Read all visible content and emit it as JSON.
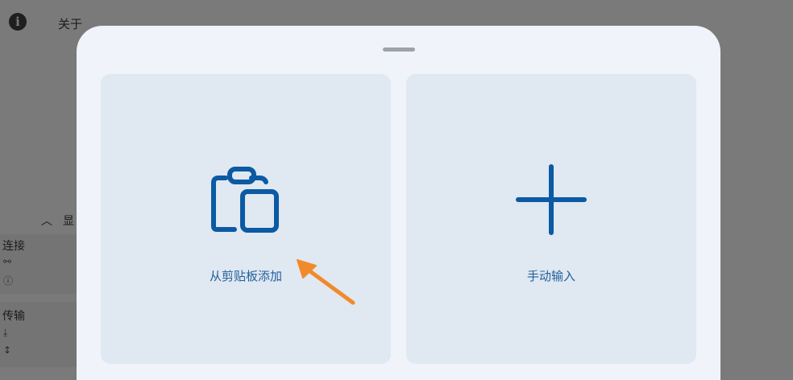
{
  "background_page": {
    "about_label": "关于",
    "section_title_partial": "显",
    "connection_card": {
      "title": "连接"
    },
    "transfer_card": {
      "title": "传输"
    }
  },
  "sheet": {
    "options": [
      {
        "label": "从剪贴板添加",
        "icon": "clipboard-icon"
      },
      {
        "label": "手动输入",
        "icon": "plus-icon"
      }
    ]
  },
  "colors": {
    "scrim": "#7a7a7a",
    "sheet_bg": "#f0f4fa",
    "card_bg": "#e0e8f2",
    "accent": "#0b5aa3",
    "annotation_arrow": "#f08a2a"
  }
}
